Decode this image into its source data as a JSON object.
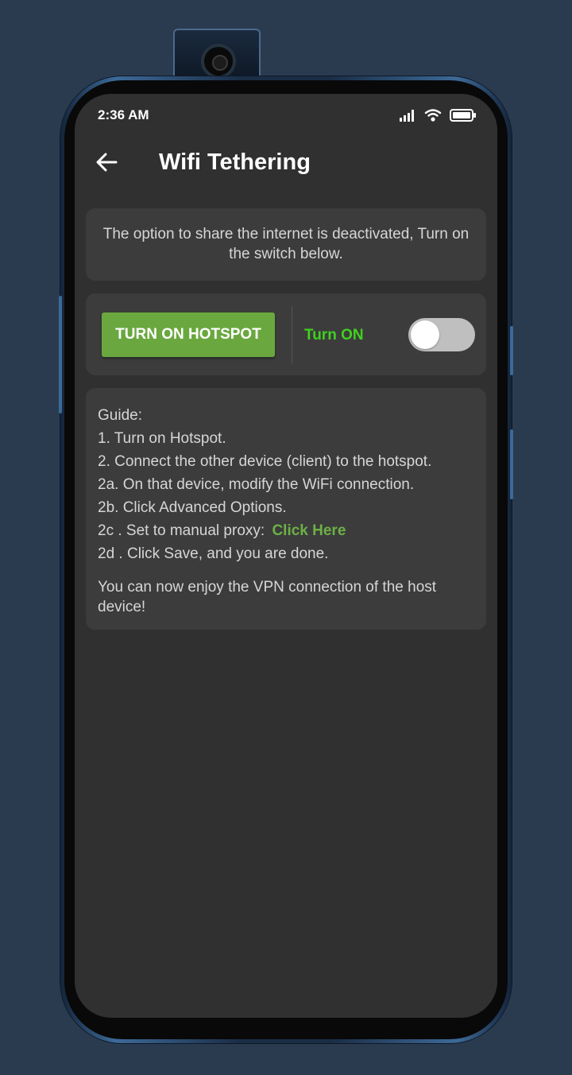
{
  "status_bar": {
    "time": "2:36 AM",
    "icons": [
      "signal-icon",
      "wifi-icon",
      "battery-icon"
    ]
  },
  "app_bar": {
    "back_icon": "arrow-left-icon",
    "title": "Wifi Tethering"
  },
  "info_card": {
    "text": "The option to share the internet is deactivated, Turn on the switch below."
  },
  "hotspot_card": {
    "button_label": "TURN ON HOTSPOT",
    "switch_label": "Turn ON",
    "switch_on": false
  },
  "guide": {
    "heading": "Guide:",
    "steps": [
      "1. Turn on Hotspot.",
      "2. Connect the other device (client) to the hotspot.",
      "2a. On that device, modify the WiFi connection.",
      "2b. Click Advanced Options.",
      "2c . Set to manual proxy:",
      "2d . Click Save, and you are done."
    ],
    "link_label": "Click Here",
    "footer": "You can now enjoy the VPN connection of the host device!"
  },
  "colors": {
    "background": "#2b3b4f",
    "screen": "#303030",
    "card": "#3c3c3c",
    "button_green": "#6aa83f",
    "label_green": "#3fd11f",
    "link_green": "#6cb046"
  }
}
